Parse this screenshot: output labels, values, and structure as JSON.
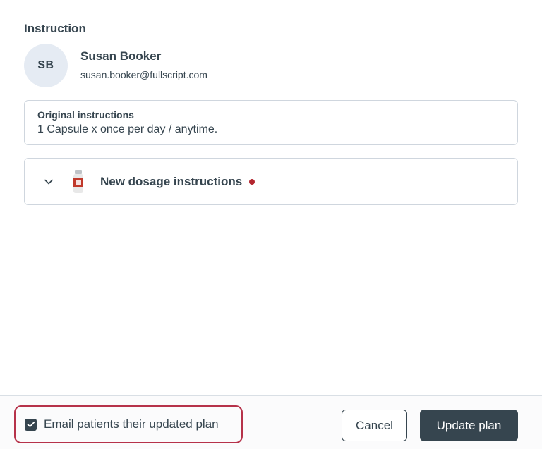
{
  "section": {
    "title": "Instruction"
  },
  "patient": {
    "initials": "SB",
    "name": "Susan Booker",
    "email": "susan.booker@fullscript.com"
  },
  "original_instructions": {
    "label": "Original instructions",
    "text": "1 Capsule x once per day / anytime."
  },
  "dosage": {
    "title": "New dosage instructions",
    "expand_icon": "chevron-down-icon",
    "product_icon": "supplement-bottle-icon",
    "status_color": "#b3262f"
  },
  "footer": {
    "email_option": {
      "label": "Email patients their updated plan",
      "checked": true,
      "highlight_color": "#b6324a"
    },
    "cancel_label": "Cancel",
    "update_label": "Update plan"
  },
  "colors": {
    "text": "#36454f",
    "primary_button": "#36454f",
    "avatar_bg": "#e5ebf3",
    "border": "#cfd6de"
  }
}
